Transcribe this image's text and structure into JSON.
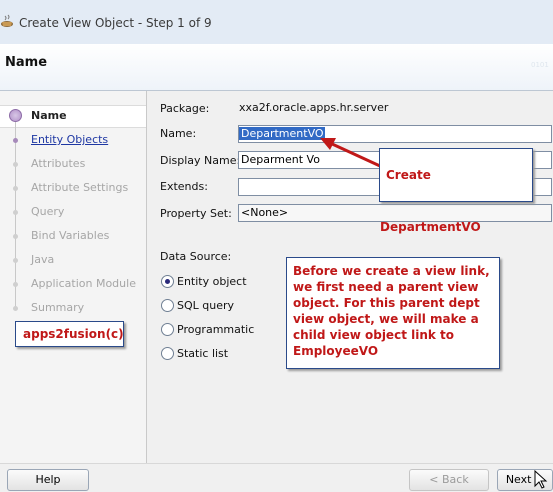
{
  "window": {
    "title": "Create View Object - Step 1 of 9"
  },
  "header": {
    "title": "Name",
    "deco": "0101"
  },
  "steps": [
    {
      "label": "Name",
      "state": "active"
    },
    {
      "label": "Entity Objects",
      "state": "link"
    },
    {
      "label": "Attributes",
      "state": "disabled"
    },
    {
      "label": "Attribute Settings",
      "state": "disabled"
    },
    {
      "label": "Query",
      "state": "disabled"
    },
    {
      "label": "Bind Variables",
      "state": "disabled"
    },
    {
      "label": "Java",
      "state": "disabled"
    },
    {
      "label": "Application Module",
      "state": "disabled"
    },
    {
      "label": "Summary",
      "state": "disabled"
    }
  ],
  "form": {
    "package_label": "Package:",
    "package_value": "xxa2f.oracle.apps.hr.server",
    "name_label": "Name:",
    "name_value": "DepartmentVO",
    "display_name_label": "Display Name:",
    "display_name_value": "Deparment Vo",
    "extends_label": "Extends:",
    "extends_value": "",
    "property_set_label": "Property Set:",
    "property_set_value": "<None>",
    "data_source_label": "Data Source:",
    "data_sources": [
      {
        "label": "Entity object",
        "selected": true
      },
      {
        "label": "SQL query",
        "selected": false
      },
      {
        "label": "Programmatic",
        "selected": false
      },
      {
        "label": "Static list",
        "selected": false
      }
    ]
  },
  "annotations": {
    "create_vo": "Create DepartmentVO",
    "note": "Before we create a view link, we first need a parent view object. For this parent dept view object, we will make a child view object link to EmployeeVO",
    "watermark": "apps2fusion(c)"
  },
  "footer": {
    "help": "Help",
    "back": "< Back",
    "next": "Next >"
  },
  "colors": {
    "accent": "#316ac5",
    "callout_text": "#c01818",
    "arrow": "#c01818",
    "link": "#1e37a3"
  }
}
